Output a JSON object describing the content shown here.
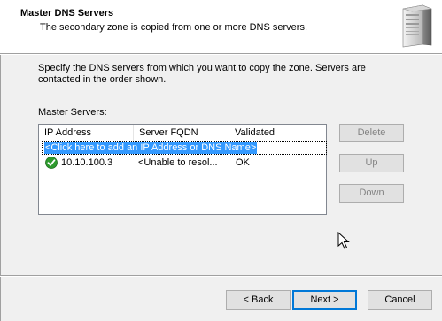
{
  "header": {
    "title": "Master DNS Servers",
    "subtitle": "The secondary zone is copied from one or more DNS servers.",
    "icon": "server-tower-icon"
  },
  "instructions": "Specify the DNS servers from which you want to copy the zone.  Servers are contacted in the order shown.",
  "list_label": "Master Servers:",
  "list": {
    "columns": [
      "IP Address",
      "Server FQDN",
      "Validated"
    ],
    "add_prompt": "<Click here to add an IP Address or DNS Name>",
    "rows": [
      {
        "status_icon": "green-check-icon",
        "ip": "10.10.100.3",
        "fqdn": "<Unable to resol...",
        "validated": "OK"
      }
    ]
  },
  "side_buttons": {
    "delete": "Delete",
    "up": "Up",
    "down": "Down"
  },
  "nav_buttons": {
    "back": "< Back",
    "next": "Next >",
    "cancel": "Cancel"
  },
  "colors": {
    "selection": "#3399ff",
    "header_bg": "#ffffff",
    "dialog_bg": "#f0f0f0",
    "check_green": "#2e9b2e"
  }
}
